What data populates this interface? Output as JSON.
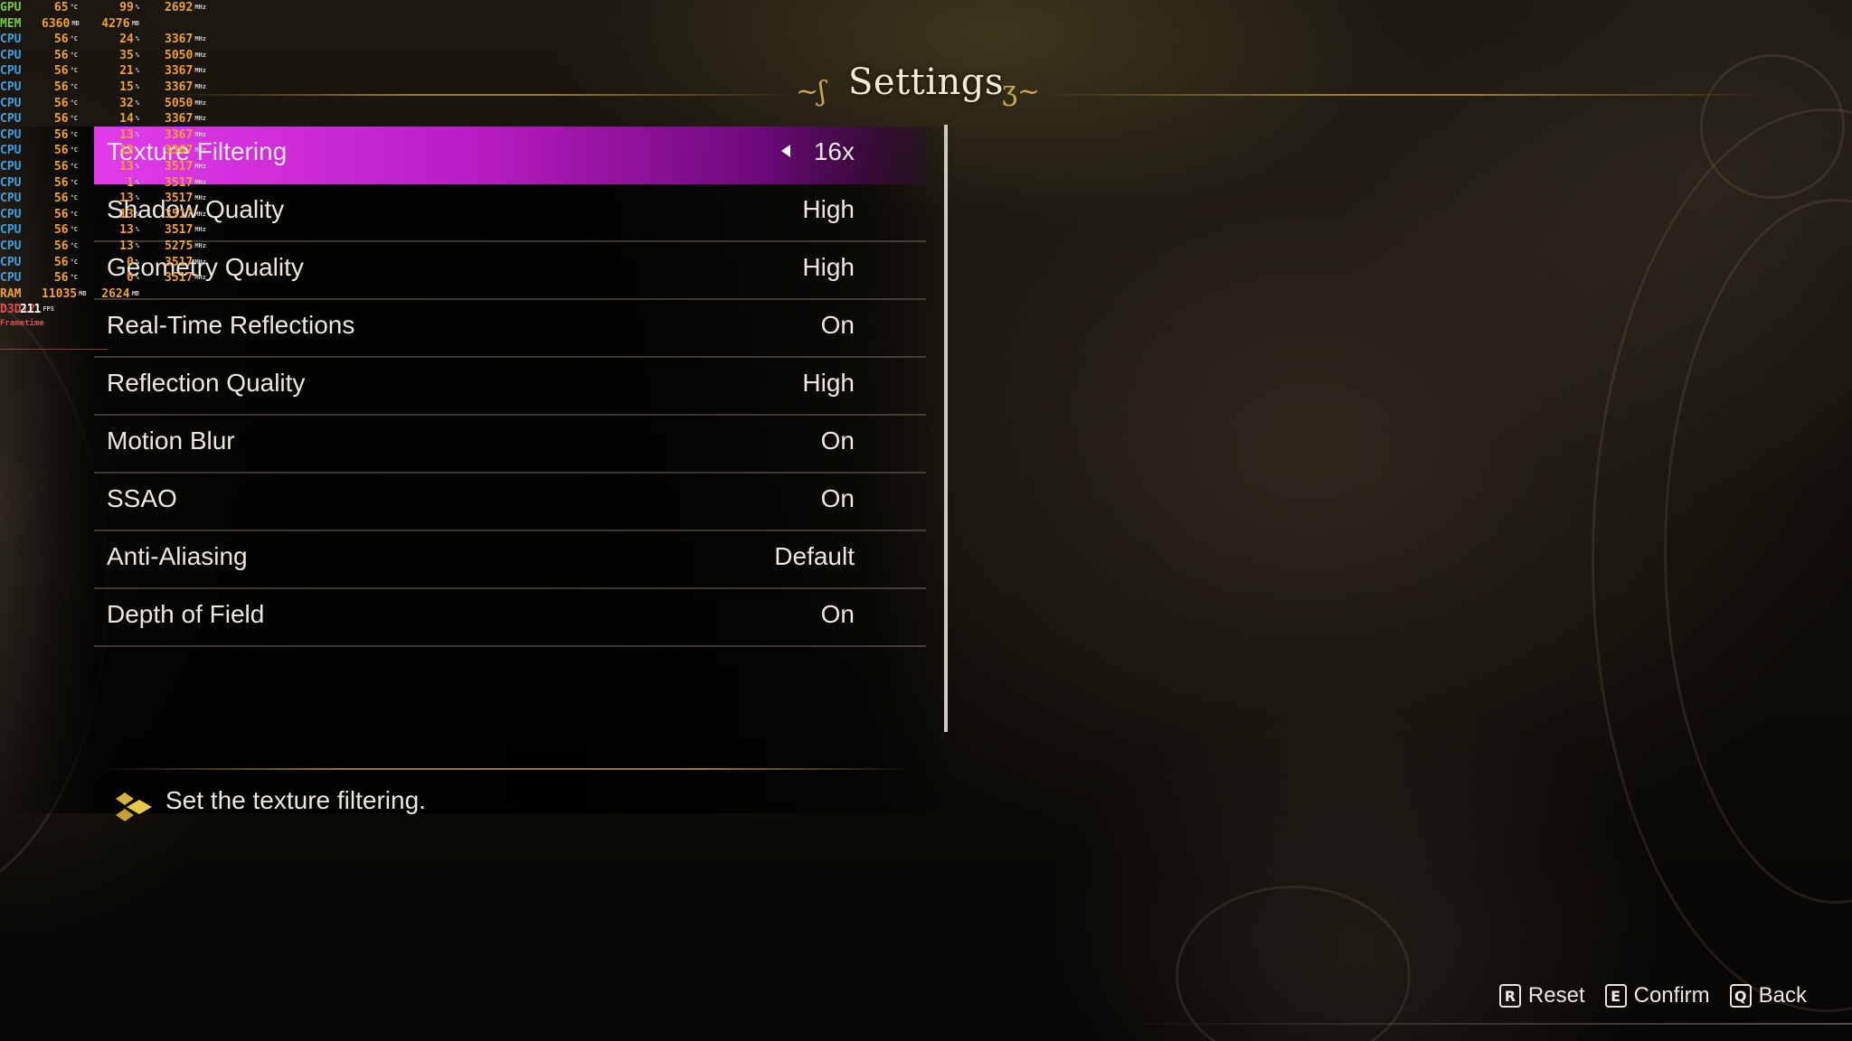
{
  "header": {
    "title": "Settings"
  },
  "settings": [
    {
      "label": "Texture Filtering",
      "value": "16x",
      "selected": true
    },
    {
      "label": "Shadow Quality",
      "value": "High",
      "selected": false
    },
    {
      "label": "Geometry Quality",
      "value": "High",
      "selected": false
    },
    {
      "label": "Real-Time Reflections",
      "value": "On",
      "selected": false
    },
    {
      "label": "Reflection Quality",
      "value": "High",
      "selected": false
    },
    {
      "label": "Motion Blur",
      "value": "On",
      "selected": false
    },
    {
      "label": "SSAO",
      "value": "On",
      "selected": false
    },
    {
      "label": "Anti-Aliasing",
      "value": "Default",
      "selected": false
    },
    {
      "label": "Depth of Field",
      "value": "On",
      "selected": false
    }
  ],
  "description": {
    "text": "Set the texture filtering.",
    "icon": "diamond-icon"
  },
  "controls": [
    {
      "key": "R",
      "label": "Reset"
    },
    {
      "key": "E",
      "label": "Confirm"
    },
    {
      "key": "Q",
      "label": "Back"
    }
  ],
  "overlay": {
    "rows": [
      {
        "name": "GPU",
        "v1": "65",
        "u1": "°C",
        "v2": "99",
        "u2": "%",
        "v3": "2692",
        "u3": "MHz"
      },
      {
        "name": "MEM",
        "v1": "6360",
        "u1": "MB",
        "v2": "4276",
        "u2": "MB",
        "v3": "",
        "u3": ""
      },
      {
        "name": "CPU",
        "v1": "56",
        "u1": "°C",
        "v2": "24",
        "u2": "%",
        "v3": "3367",
        "u3": "MHz"
      },
      {
        "name": "CPU",
        "v1": "56",
        "u1": "°C",
        "v2": "35",
        "u2": "%",
        "v3": "5050",
        "u3": "MHz"
      },
      {
        "name": "CPU",
        "v1": "56",
        "u1": "°C",
        "v2": "21",
        "u2": "%",
        "v3": "3367",
        "u3": "MHz"
      },
      {
        "name": "CPU",
        "v1": "56",
        "u1": "°C",
        "v2": "15",
        "u2": "%",
        "v3": "3367",
        "u3": "MHz"
      },
      {
        "name": "CPU",
        "v1": "56",
        "u1": "°C",
        "v2": "32",
        "u2": "%",
        "v3": "5050",
        "u3": "MHz"
      },
      {
        "name": "CPU",
        "v1": "56",
        "u1": "°C",
        "v2": "14",
        "u2": "%",
        "v3": "3367",
        "u3": "MHz"
      },
      {
        "name": "CPU",
        "v1": "56",
        "u1": "°C",
        "v2": "13",
        "u2": "%",
        "v3": "3367",
        "u3": "MHz"
      },
      {
        "name": "CPU",
        "v1": "56",
        "u1": "°C",
        "v2": "13",
        "u2": "%",
        "v3": "3367",
        "u3": "MHz"
      },
      {
        "name": "CPU",
        "v1": "56",
        "u1": "°C",
        "v2": "13",
        "u2": "%",
        "v3": "3517",
        "u3": "MHz"
      },
      {
        "name": "CPU",
        "v1": "56",
        "u1": "°C",
        "v2": "1",
        "u2": "%",
        "v3": "3517",
        "u3": "MHz"
      },
      {
        "name": "CPU",
        "v1": "56",
        "u1": "°C",
        "v2": "13",
        "u2": "%",
        "v3": "3517",
        "u3": "MHz"
      },
      {
        "name": "CPU",
        "v1": "56",
        "u1": "°C",
        "v2": "13",
        "u2": "%",
        "v3": "3517",
        "u3": "MHz"
      },
      {
        "name": "CPU",
        "v1": "56",
        "u1": "°C",
        "v2": "13",
        "u2": "%",
        "v3": "3517",
        "u3": "MHz"
      },
      {
        "name": "CPU",
        "v1": "56",
        "u1": "°C",
        "v2": "13",
        "u2": "%",
        "v3": "5275",
        "u3": "MHz"
      },
      {
        "name": "CPU",
        "v1": "56",
        "u1": "°C",
        "v2": "0",
        "u2": "%",
        "v3": "3517",
        "u3": "MHz"
      },
      {
        "name": "CPU",
        "v1": "56",
        "u1": "°C",
        "v2": "0",
        "u2": "%",
        "v3": "3517",
        "u3": "MHz"
      },
      {
        "name": "RAM",
        "v1": "11035",
        "u1": "MB",
        "v2": "2624",
        "u2": "MB",
        "v3": "",
        "u3": ""
      },
      {
        "name": "D3D12",
        "v1": "211",
        "u1": "FPS",
        "v2": "",
        "u2": "",
        "v3": "",
        "u3": ""
      }
    ],
    "frametime_label": "Frametime",
    "colors": {
      "gpu": "#7ac943",
      "mem": "#7ac943",
      "cpu": "#3ca0e0",
      "ram": "#f0a030",
      "d3d12": "#e05050",
      "values": "#f0a030"
    }
  },
  "colors": {
    "selection": "#d83ce0",
    "text": "#ece8df",
    "accent_gold": "#c8a558"
  }
}
